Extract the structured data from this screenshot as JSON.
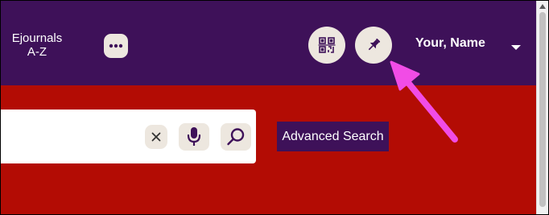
{
  "header": {
    "ejournals_label": "Ejournals A-Z",
    "user_name": "Your, Name",
    "more_icon": "ellipsis-icon",
    "qr_icon": "qr-code-icon",
    "pin_icon": "pin-icon",
    "account_caret_icon": "chevron-down-icon"
  },
  "search": {
    "value": "",
    "clear_icon": "close-icon",
    "mic_icon": "microphone-icon",
    "search_icon": "magnifier-icon",
    "advanced_label": "Advanced Search"
  },
  "annotation": {
    "pointer": "magenta-arrow-pointing-to-pin-button"
  },
  "colors": {
    "header_bg": "#3e1159",
    "banner_bg": "#b30c04",
    "button_bg": "#ede7df",
    "arrow": "#f14ce6",
    "icon": "#3e1159"
  }
}
